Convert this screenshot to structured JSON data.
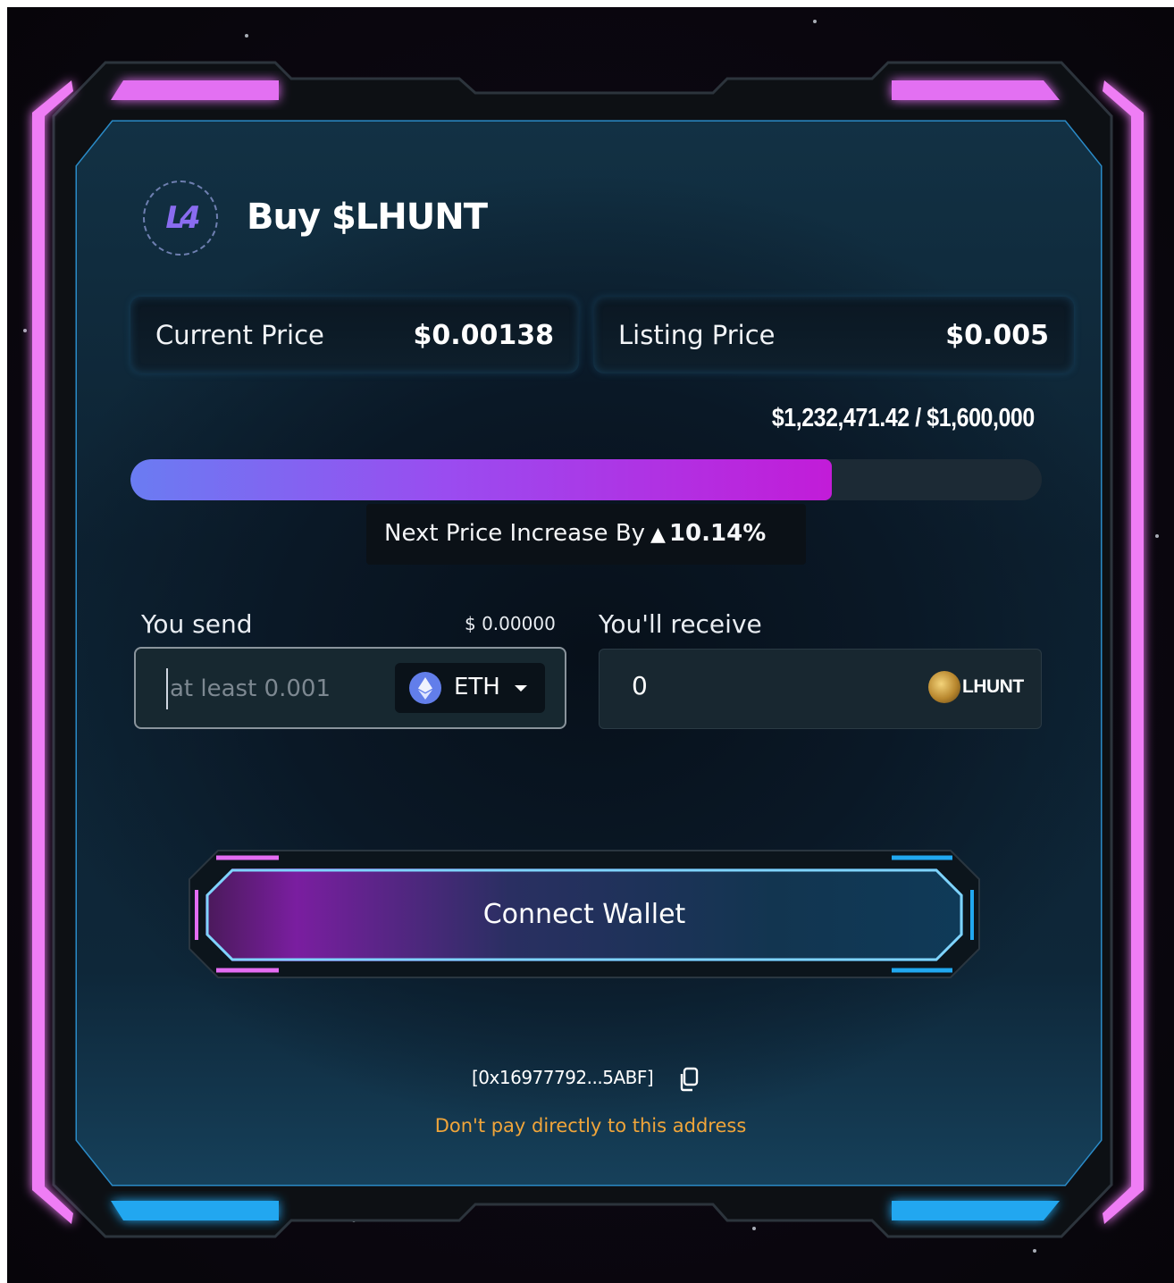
{
  "widget": {
    "title": "Buy $LHUNT",
    "logo_icon": "lhunt-logo-icon"
  },
  "prices": {
    "current_label": "Current Price",
    "current_value": "$0.00138",
    "listing_label": "Listing Price",
    "listing_value": "$0.005"
  },
  "progress": {
    "raised_text": "$1,232,471.42 / $1,600,000",
    "fill_fraction": 0.77,
    "next_increase_label": "Next Price Increase By",
    "next_increase_value": "10.14%"
  },
  "send": {
    "label": "You send",
    "usd_value": "$ 0.00000",
    "placeholder": "at least 0.001",
    "token": "ETH",
    "token_icon": "ethereum-icon"
  },
  "receive": {
    "label": "You'll receive",
    "value": "0",
    "token": "LHUNT",
    "token_icon": "lhunt-coin-icon"
  },
  "connect_button_label": "Connect Wallet",
  "address": "[0x16977792...5ABF]",
  "warning": "Don't pay directly to this address",
  "colors": {
    "magenta": "#e46cf2",
    "cyan": "#21a8f0",
    "warning": "#f0a53a",
    "progress_start": "#6a7cf2",
    "progress_end": "#c21cd8"
  }
}
